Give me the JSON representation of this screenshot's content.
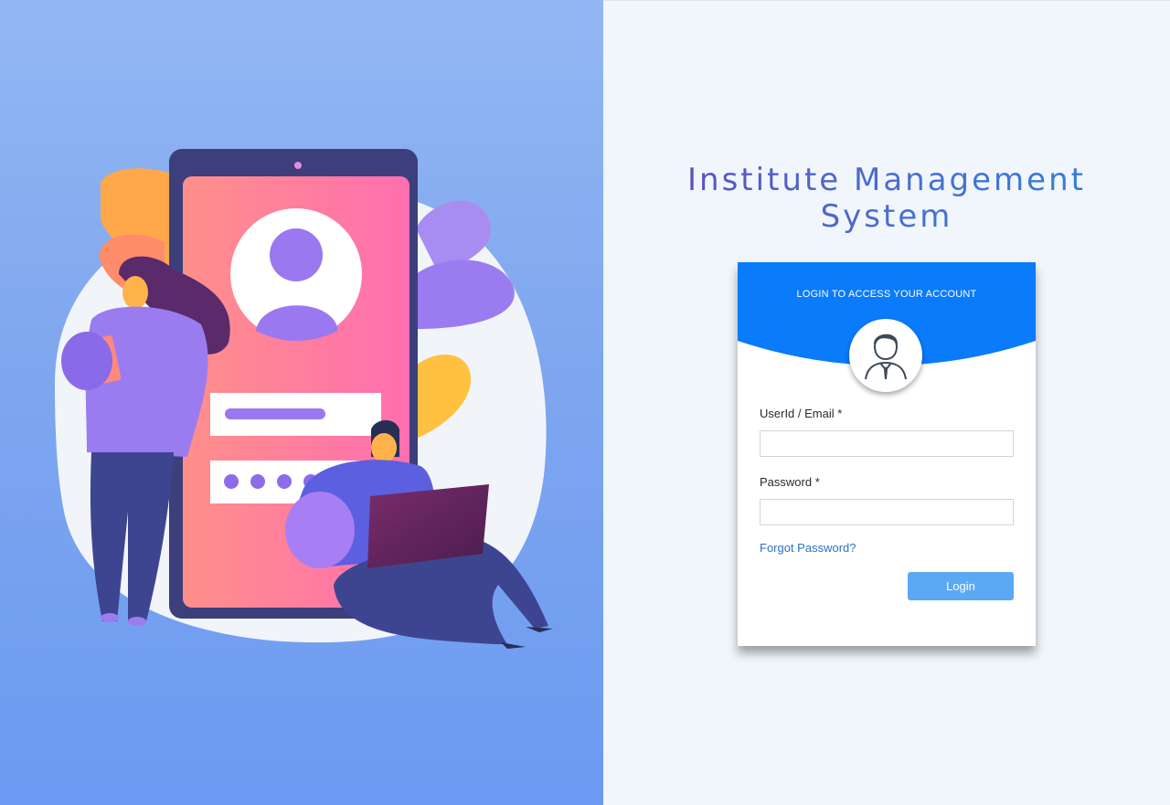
{
  "app": {
    "title": "Institute Management System"
  },
  "login_card": {
    "header_title": "LOGIN TO ACCESS YOUR ACCOUNT",
    "userid_label": "UserId / Email *",
    "userid_value": "",
    "userid_placeholder": "",
    "password_label": "Password *",
    "password_value": "",
    "password_placeholder": "",
    "forgot_password": "Forgot Password?",
    "login_button": "Login"
  },
  "colors": {
    "left_panel_gradient_top": "#93b7f3",
    "left_panel_gradient_bottom": "#6c9af2",
    "right_panel_background": "#f0f6fc",
    "card_header": "#0a7bfa",
    "login_button": "#5ba8f5",
    "link": "#2a72c9",
    "title_gradient_start": "#5b4fbf",
    "title_gradient_end": "#2f7fd8"
  },
  "icons": {
    "illustration": "login-illustration",
    "avatar": "user-avatar-icon"
  }
}
